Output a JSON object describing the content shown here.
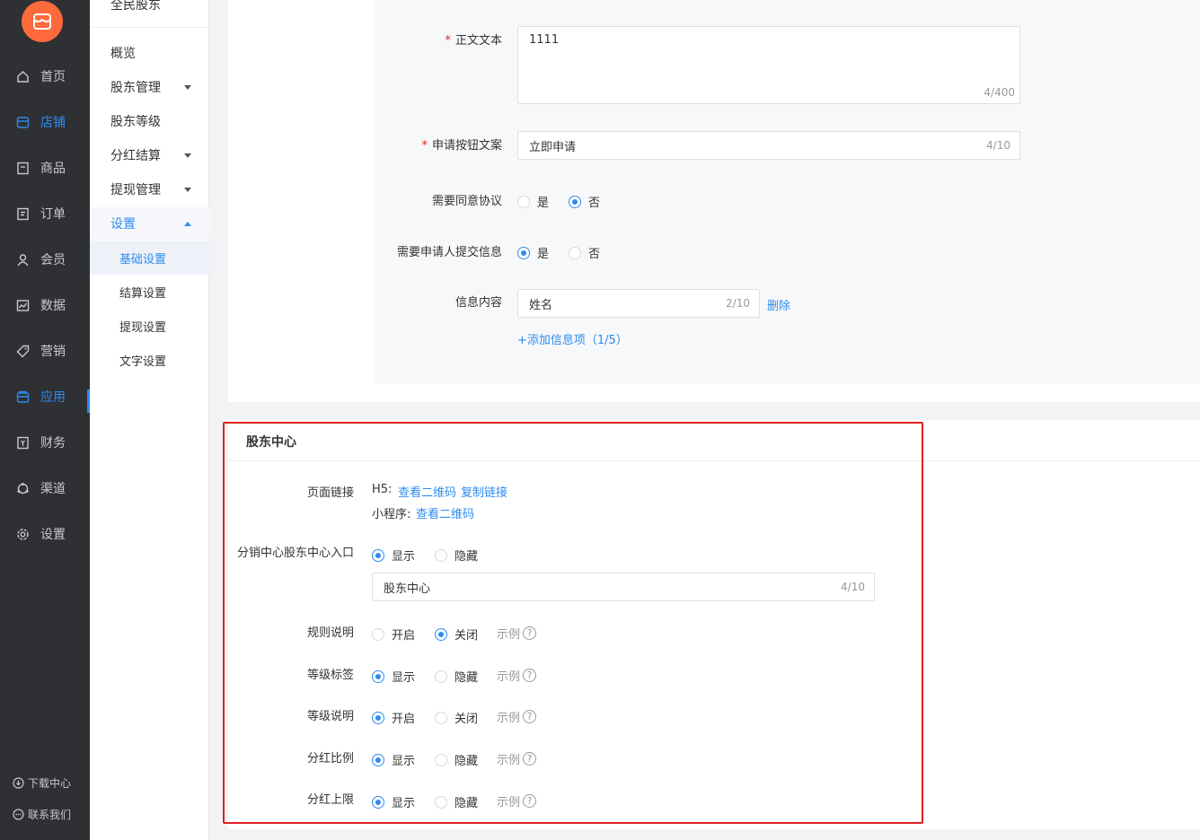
{
  "nav1": {
    "items": [
      {
        "label": "首页",
        "icon": "home-icon"
      },
      {
        "label": "店铺",
        "icon": "store-icon"
      },
      {
        "label": "商品",
        "icon": "goods-icon"
      },
      {
        "label": "订单",
        "icon": "order-icon"
      },
      {
        "label": "会员",
        "icon": "member-icon"
      },
      {
        "label": "数据",
        "icon": "chart-icon"
      },
      {
        "label": "营销",
        "icon": "tag-icon"
      },
      {
        "label": "应用",
        "icon": "app-icon"
      },
      {
        "label": "财务",
        "icon": "finance-icon"
      },
      {
        "label": "渠道",
        "icon": "channel-icon"
      },
      {
        "label": "设置",
        "icon": "gear-icon"
      }
    ],
    "download": "下载中心",
    "contact": "联系我们",
    "accent": "#2d8cf0",
    "logo_color": "#ff6a3d"
  },
  "nav2": {
    "title": "全民股东",
    "items": [
      "概览",
      "股东管理",
      "股东等级",
      "分红结算",
      "提现管理",
      "设置"
    ],
    "subs": [
      "基础设置",
      "结算设置",
      "提现设置",
      "文字设置"
    ]
  },
  "form_top": {
    "body_label": "正文文本",
    "body_value": "1111",
    "body_count": "4/400",
    "apply_label": "申请按钮文案",
    "apply_value": "立即申请",
    "apply_count": "4/10",
    "agree_label": "需要同意协议",
    "agree_yes": "是",
    "agree_no": "否",
    "submit_label": "需要申请人提交信息",
    "submit_yes": "是",
    "submit_no": "否",
    "info_label": "信息内容",
    "info_value": "姓名",
    "info_count": "2/10",
    "delete": "删除",
    "add_info": "+添加信息项（1/5）"
  },
  "center": {
    "title": "股东中心",
    "page_link_label": "页面链接",
    "h5_label": "H5:",
    "view_qr": "查看二维码",
    "copy_link": "复制链接",
    "mini_label": "小程序:",
    "mini_view_qr": "查看二维码",
    "entry_label": "分销中心股东中心入口",
    "entry_show": "显示",
    "entry_hide": "隐藏",
    "entry_value": "股东中心",
    "entry_count": "4/10",
    "example": "示例",
    "rules_label": "规则说明",
    "rules_on": "开启",
    "rules_off": "关闭",
    "level_tag_label": "等级标签",
    "level_tag_show": "显示",
    "level_tag_hide": "隐藏",
    "level_desc_label": "等级说明",
    "level_desc_on": "开启",
    "level_desc_off": "关闭",
    "ratio_label": "分红比例",
    "ratio_show": "显示",
    "ratio_hide": "隐藏",
    "limit_label": "分红上限",
    "limit_show": "显示",
    "limit_hide": "隐藏"
  }
}
